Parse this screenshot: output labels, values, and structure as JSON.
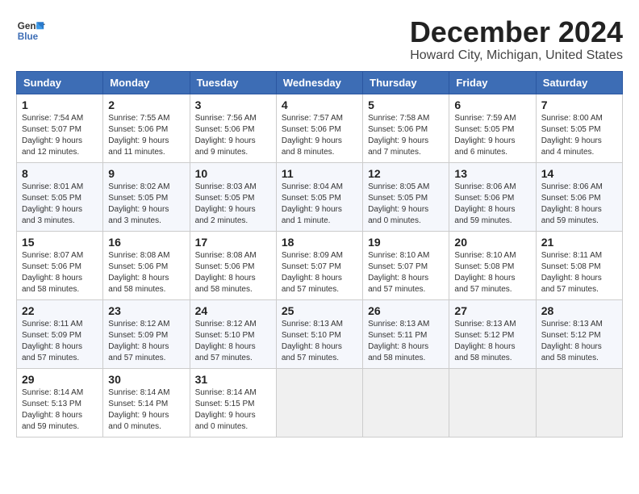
{
  "logo": {
    "line1": "General",
    "line2": "Blue"
  },
  "title": "December 2024",
  "subtitle": "Howard City, Michigan, United States",
  "headers": [
    "Sunday",
    "Monday",
    "Tuesday",
    "Wednesday",
    "Thursday",
    "Friday",
    "Saturday"
  ],
  "weeks": [
    [
      {
        "day": "1",
        "sunrise": "7:54 AM",
        "sunset": "5:07 PM",
        "daylight": "9 hours and 12 minutes."
      },
      {
        "day": "2",
        "sunrise": "7:55 AM",
        "sunset": "5:06 PM",
        "daylight": "9 hours and 11 minutes."
      },
      {
        "day": "3",
        "sunrise": "7:56 AM",
        "sunset": "5:06 PM",
        "daylight": "9 hours and 9 minutes."
      },
      {
        "day": "4",
        "sunrise": "7:57 AM",
        "sunset": "5:06 PM",
        "daylight": "9 hours and 8 minutes."
      },
      {
        "day": "5",
        "sunrise": "7:58 AM",
        "sunset": "5:06 PM",
        "daylight": "9 hours and 7 minutes."
      },
      {
        "day": "6",
        "sunrise": "7:59 AM",
        "sunset": "5:05 PM",
        "daylight": "9 hours and 6 minutes."
      },
      {
        "day": "7",
        "sunrise": "8:00 AM",
        "sunset": "5:05 PM",
        "daylight": "9 hours and 4 minutes."
      }
    ],
    [
      {
        "day": "8",
        "sunrise": "8:01 AM",
        "sunset": "5:05 PM",
        "daylight": "9 hours and 3 minutes."
      },
      {
        "day": "9",
        "sunrise": "8:02 AM",
        "sunset": "5:05 PM",
        "daylight": "9 hours and 3 minutes."
      },
      {
        "day": "10",
        "sunrise": "8:03 AM",
        "sunset": "5:05 PM",
        "daylight": "9 hours and 2 minutes."
      },
      {
        "day": "11",
        "sunrise": "8:04 AM",
        "sunset": "5:05 PM",
        "daylight": "9 hours and 1 minute."
      },
      {
        "day": "12",
        "sunrise": "8:05 AM",
        "sunset": "5:05 PM",
        "daylight": "9 hours and 0 minutes."
      },
      {
        "day": "13",
        "sunrise": "8:06 AM",
        "sunset": "5:06 PM",
        "daylight": "8 hours and 59 minutes."
      },
      {
        "day": "14",
        "sunrise": "8:06 AM",
        "sunset": "5:06 PM",
        "daylight": "8 hours and 59 minutes."
      }
    ],
    [
      {
        "day": "15",
        "sunrise": "8:07 AM",
        "sunset": "5:06 PM",
        "daylight": "8 hours and 58 minutes."
      },
      {
        "day": "16",
        "sunrise": "8:08 AM",
        "sunset": "5:06 PM",
        "daylight": "8 hours and 58 minutes."
      },
      {
        "day": "17",
        "sunrise": "8:08 AM",
        "sunset": "5:06 PM",
        "daylight": "8 hours and 58 minutes."
      },
      {
        "day": "18",
        "sunrise": "8:09 AM",
        "sunset": "5:07 PM",
        "daylight": "8 hours and 57 minutes."
      },
      {
        "day": "19",
        "sunrise": "8:10 AM",
        "sunset": "5:07 PM",
        "daylight": "8 hours and 57 minutes."
      },
      {
        "day": "20",
        "sunrise": "8:10 AM",
        "sunset": "5:08 PM",
        "daylight": "8 hours and 57 minutes."
      },
      {
        "day": "21",
        "sunrise": "8:11 AM",
        "sunset": "5:08 PM",
        "daylight": "8 hours and 57 minutes."
      }
    ],
    [
      {
        "day": "22",
        "sunrise": "8:11 AM",
        "sunset": "5:09 PM",
        "daylight": "8 hours and 57 minutes."
      },
      {
        "day": "23",
        "sunrise": "8:12 AM",
        "sunset": "5:09 PM",
        "daylight": "8 hours and 57 minutes."
      },
      {
        "day": "24",
        "sunrise": "8:12 AM",
        "sunset": "5:10 PM",
        "daylight": "8 hours and 57 minutes."
      },
      {
        "day": "25",
        "sunrise": "8:13 AM",
        "sunset": "5:10 PM",
        "daylight": "8 hours and 57 minutes."
      },
      {
        "day": "26",
        "sunrise": "8:13 AM",
        "sunset": "5:11 PM",
        "daylight": "8 hours and 58 minutes."
      },
      {
        "day": "27",
        "sunrise": "8:13 AM",
        "sunset": "5:12 PM",
        "daylight": "8 hours and 58 minutes."
      },
      {
        "day": "28",
        "sunrise": "8:13 AM",
        "sunset": "5:12 PM",
        "daylight": "8 hours and 58 minutes."
      }
    ],
    [
      {
        "day": "29",
        "sunrise": "8:14 AM",
        "sunset": "5:13 PM",
        "daylight": "8 hours and 59 minutes."
      },
      {
        "day": "30",
        "sunrise": "8:14 AM",
        "sunset": "5:14 PM",
        "daylight": "9 hours and 0 minutes."
      },
      {
        "day": "31",
        "sunrise": "8:14 AM",
        "sunset": "5:15 PM",
        "daylight": "9 hours and 0 minutes."
      },
      null,
      null,
      null,
      null
    ]
  ]
}
